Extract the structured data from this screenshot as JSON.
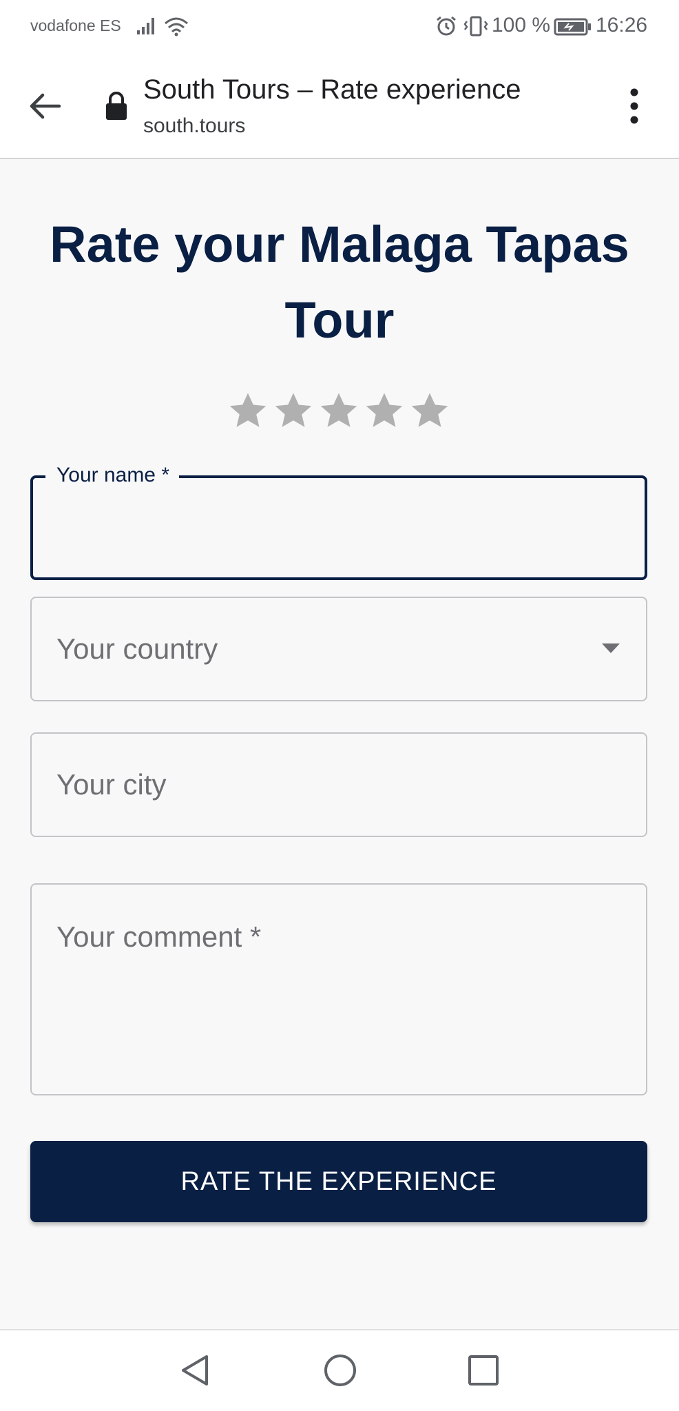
{
  "status_bar": {
    "carrier": "vodafone ES",
    "battery_percent": "100 %",
    "time": "16:26",
    "icons": [
      "signal-icon",
      "wifi-icon",
      "alarm-icon",
      "vibrate-icon",
      "battery-icon"
    ]
  },
  "browser": {
    "page_title": "South Tours – Rate experience",
    "url": "south.tours",
    "icons": [
      "back-arrow-icon",
      "lock-icon",
      "more-vert-icon"
    ]
  },
  "form": {
    "heading": "Rate your Malaga Tapas Tour",
    "rating": {
      "max": 5,
      "selected": 0,
      "empty_color": "#b0b0b0"
    },
    "name_label": "Your name *",
    "country_placeholder": "Your country",
    "city_placeholder": "Your city",
    "comment_placeholder": "Your comment *",
    "submit_label": "RATE THE EXPERIENCE"
  },
  "colors": {
    "brand": "#0a1f44",
    "page_background": "#f8f8f9",
    "field_border": "#c4c4c8",
    "placeholder": "#6e6e73"
  },
  "nav_bar": {
    "icons": [
      "nav-back-icon",
      "nav-home-icon",
      "nav-recents-icon"
    ]
  }
}
